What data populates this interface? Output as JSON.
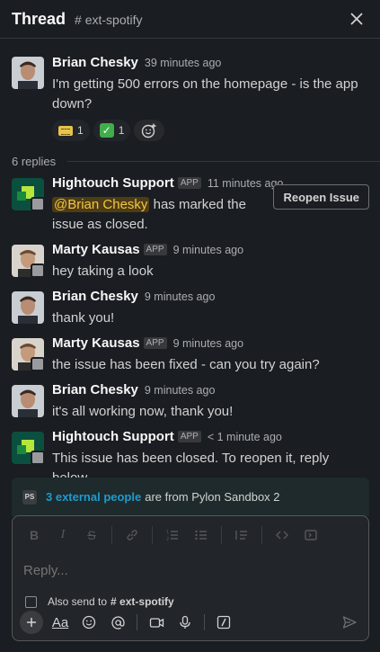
{
  "header": {
    "title": "Thread",
    "channel": "# ext-spotify"
  },
  "parent": {
    "author": "Brian Chesky",
    "time": "39 minutes ago",
    "text": "I'm getting 500 errors on the homepage - is the app down?",
    "reactions": [
      {
        "emoji": "ticket",
        "count": "1"
      },
      {
        "emoji": "check",
        "count": "1"
      }
    ]
  },
  "replies_label": "6 replies",
  "messages": [
    {
      "author": "Hightouch Support",
      "tag": "APP",
      "time": "11 minutes ago",
      "mention": "@Brian Chesky",
      "text": " has marked the issue as closed."
    },
    {
      "author": "Marty Kausas",
      "tag": "APP",
      "time": "9 minutes ago",
      "text": "hey taking a look"
    },
    {
      "author": "Brian Chesky",
      "time": "9 minutes ago",
      "text": "thank you!"
    },
    {
      "author": "Marty Kausas",
      "tag": "APP",
      "time": "9 minutes ago",
      "text": "the issue has been fixed - can you try again?"
    },
    {
      "author": "Brian Chesky",
      "time": "9 minutes ago",
      "text": "it's all working now, thank you!"
    },
    {
      "author": "Hightouch Support",
      "tag": "APP",
      "time": "< 1 minute ago",
      "text": "This issue has been closed. To reopen it, reply below."
    }
  ],
  "reopen_button": "Reopen Issue",
  "banner": {
    "badge": "PS",
    "link": "3 external people",
    "text": "are from Pylon Sandbox 2"
  },
  "composer": {
    "placeholder": "Reply...",
    "also_send": "Also send to",
    "also_send_channel": "# ext-spotify",
    "format_label": "Aa"
  },
  "colors": {
    "background": "#1a1d21",
    "mention_bg": "#4e3c15",
    "mention_fg": "#f2c744",
    "link": "#1d9bd1"
  }
}
